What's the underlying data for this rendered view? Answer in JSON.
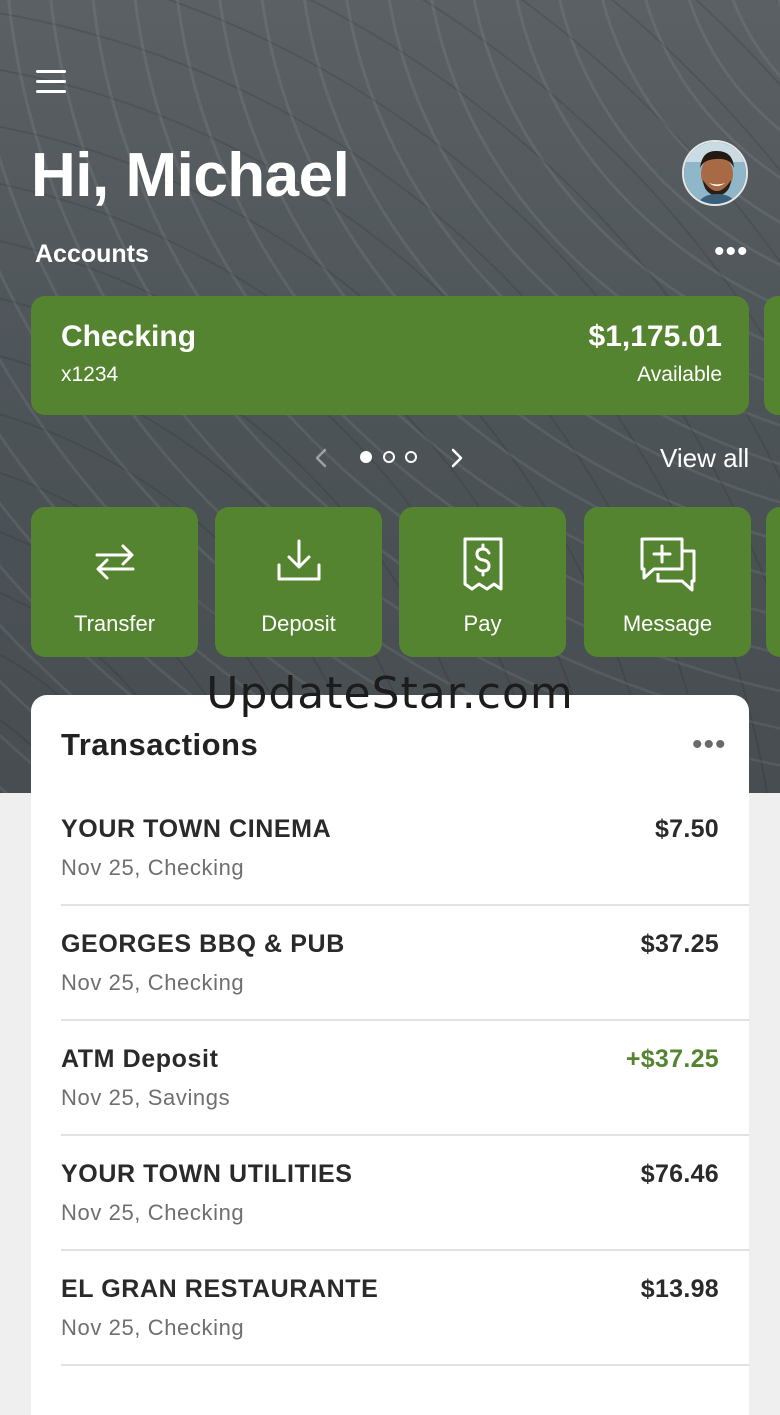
{
  "header": {
    "greeting": "Hi, Michael",
    "accounts_label": "Accounts",
    "more": "•••"
  },
  "account_card": {
    "name": "Checking",
    "number": "x1234",
    "balance": "$1,175.01",
    "balance_label": "Available"
  },
  "pager": {
    "pages": 3,
    "active_page": 1,
    "view_all": "View all"
  },
  "actions": [
    {
      "label": "Transfer",
      "icon": "transfer-icon"
    },
    {
      "label": "Deposit",
      "icon": "deposit-icon"
    },
    {
      "label": "Pay",
      "icon": "bill-pay-icon"
    },
    {
      "label": "Message",
      "icon": "message-icon"
    }
  ],
  "watermark": "UpdateStar.com",
  "transactions": {
    "title": "Transactions",
    "more": "•••",
    "items": [
      {
        "name": "YOUR TOWN CINEMA",
        "detail": "Nov 25, Checking",
        "amount": "$7.50",
        "credit": false
      },
      {
        "name": "GEORGES BBQ & PUB",
        "detail": "Nov 25, Checking",
        "amount": "$37.25",
        "credit": false
      },
      {
        "name": "ATM Deposit",
        "detail": "Nov 25, Savings",
        "amount": "+$37.25",
        "credit": true
      },
      {
        "name": "YOUR TOWN UTILITIES",
        "detail": "Nov 25, Checking",
        "amount": "$76.46",
        "credit": false
      },
      {
        "name": "EL GRAN RESTAURANTE",
        "detail": "Nov 25, Checking",
        "amount": "$13.98",
        "credit": false
      }
    ]
  },
  "colors": {
    "accent_green": "#558431",
    "credit_text": "#558431",
    "hero_background": "#4f565a"
  }
}
